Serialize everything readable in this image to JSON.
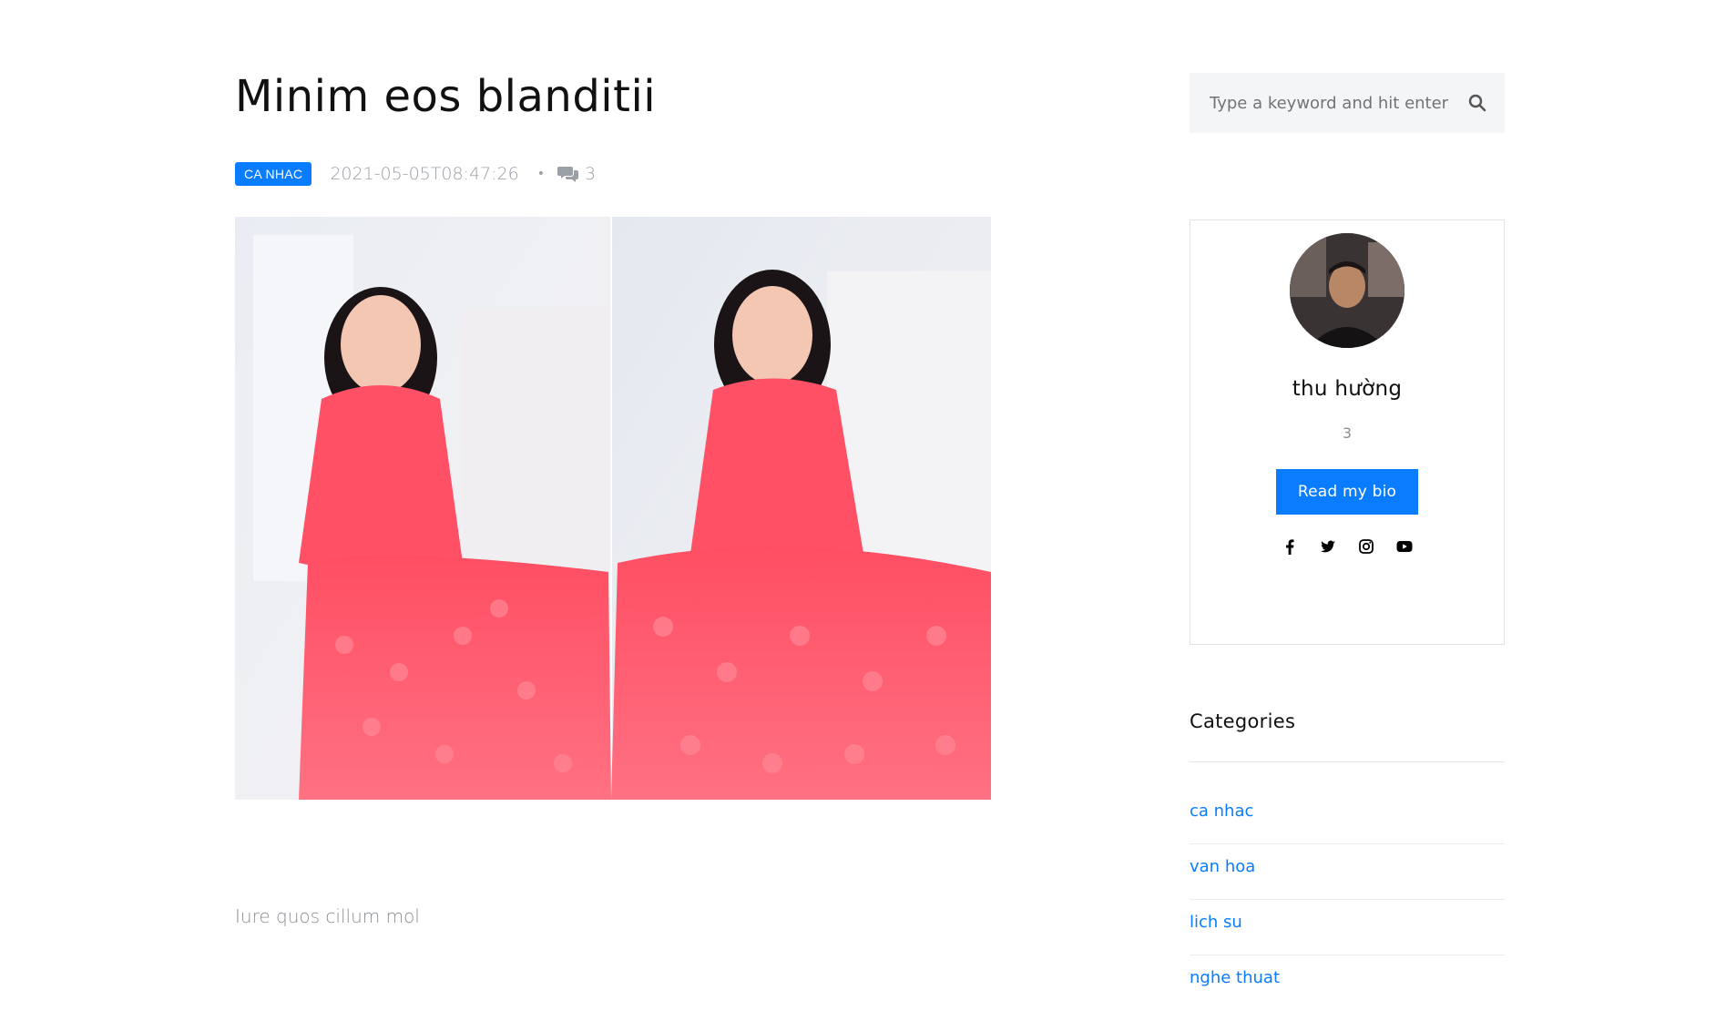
{
  "post": {
    "title": "Minim eos blanditii",
    "category": "CA NHAC",
    "date": "2021-05-05T08:47:26",
    "separator": "•",
    "comments": "3",
    "excerpt": "Iure quos cillum mol"
  },
  "search": {
    "placeholder": "Type a keyword and hit enter"
  },
  "bio": {
    "name": "thu hường",
    "count": "3",
    "button_label": "Read my bio",
    "socials": [
      "facebook-icon",
      "twitter-icon",
      "instagram-icon",
      "youtube-icon"
    ]
  },
  "categories": {
    "title": "Categories",
    "items": [
      {
        "label": "ca nhac"
      },
      {
        "label": "van hoa"
      },
      {
        "label": "lich su"
      },
      {
        "label": "nghe thuat"
      }
    ]
  },
  "colors": {
    "accent": "#0a7cff",
    "muted_text": "#9aa0a6",
    "dress": "#ff5a6e"
  }
}
